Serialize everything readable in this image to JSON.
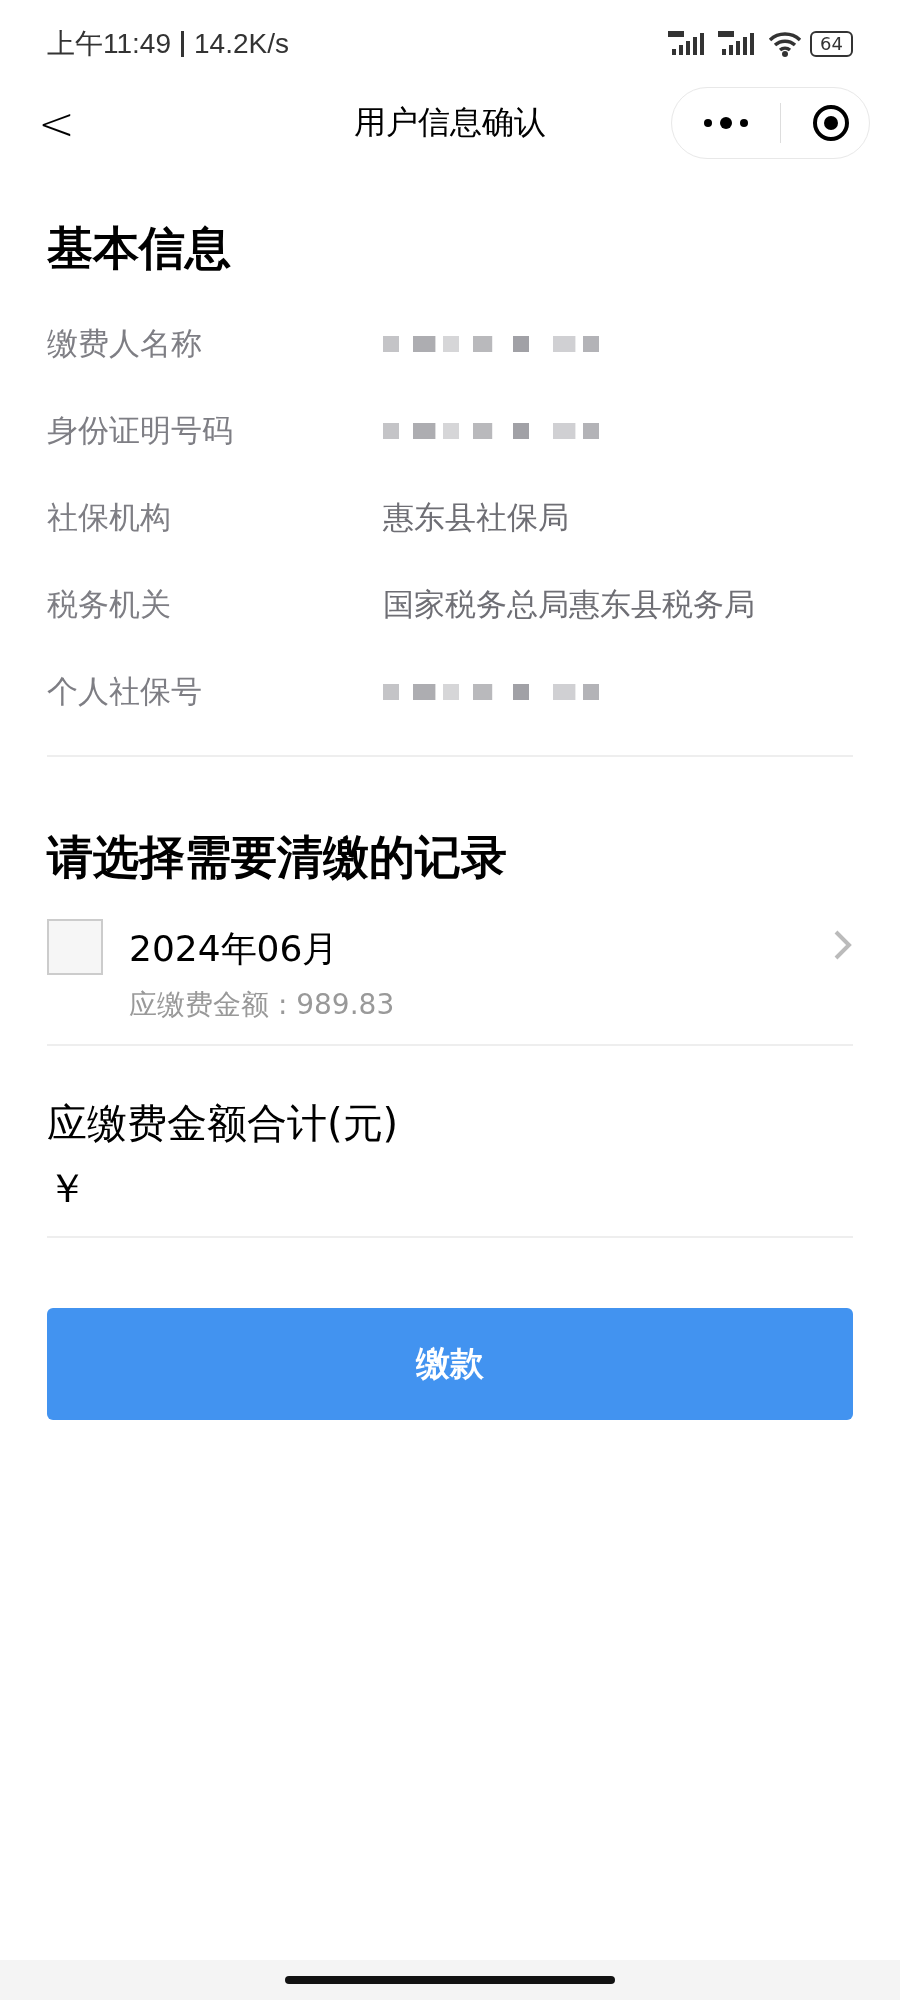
{
  "status_bar": {
    "time": "上午11:49",
    "speed": "14.2K/s",
    "battery": "64"
  },
  "nav": {
    "title": "用户信息确认",
    "back": "<"
  },
  "basic_info": {
    "heading": "基本信息",
    "rows": [
      {
        "label": "缴费人名称",
        "redacted": true
      },
      {
        "label": "身份证明号码",
        "redacted": true
      },
      {
        "label": "社保机构",
        "value": "惠东县社保局",
        "redacted": false
      },
      {
        "label": "税务机关",
        "value": "国家税务总局惠东县税务局",
        "redacted": false
      },
      {
        "label": "个人社保号",
        "redacted": true
      }
    ]
  },
  "records": {
    "heading": "请选择需要清缴的记录",
    "items": [
      {
        "period": "2024年06月",
        "amount": "应缴费金额 : 989.83",
        "checked": false
      }
    ]
  },
  "total": {
    "label": "应缴费金额合计(元)",
    "value": "￥"
  },
  "pay_button": "缴款"
}
